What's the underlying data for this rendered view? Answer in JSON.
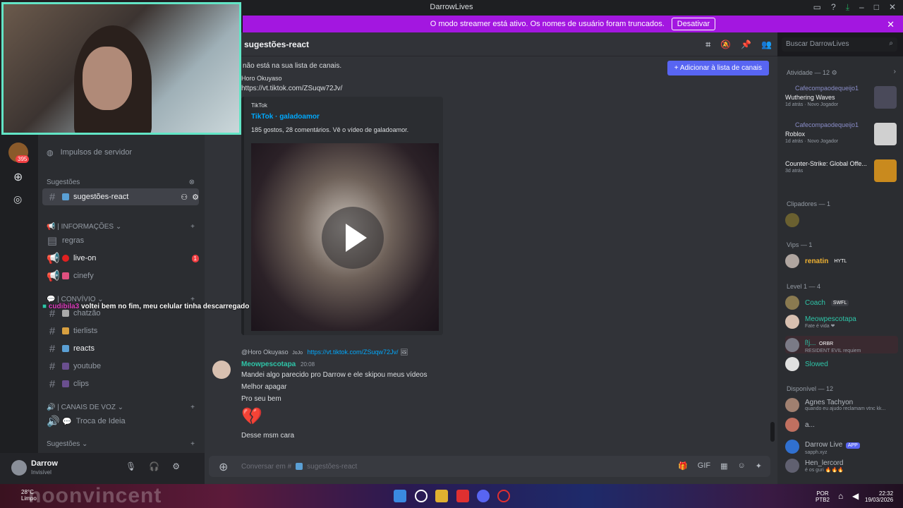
{
  "window": {
    "title": "DarrowLives"
  },
  "banner": {
    "text": "O modo streamer está ativo. Os nomes de usuário foram truncados.",
    "button": "Desativar"
  },
  "rail": {
    "badge": "395"
  },
  "sidebar": {
    "boosts": "Impulsos de servidor",
    "suggestions_header": "Sugestões",
    "active_channel": "sugestões-react",
    "cat_info": "| INFORMAÇÕES",
    "channels_info": [
      {
        "name": "regras"
      },
      {
        "name": "live-on",
        "badge": "1"
      },
      {
        "name": "cinefy"
      }
    ],
    "cat_convivio": "| CONVÍVIO",
    "channels_convivio": [
      {
        "name": "chatzão"
      },
      {
        "name": "tierlists"
      },
      {
        "name": "reacts"
      },
      {
        "name": "youtube"
      },
      {
        "name": "clips"
      }
    ],
    "cat_voice": "| CANAIS DE VOZ",
    "voice_channel": "Troca de Ideia",
    "cat_suggestions": "Sugestões"
  },
  "user": {
    "name": "Darrow",
    "status": "Invisível"
  },
  "overlay": {
    "user": "cudibila3",
    "message": "voltei bem no fim, meu celular tinha descarregado"
  },
  "chat": {
    "channel": "sugestões-react",
    "notice": "não está na sua lista de canais.",
    "add_button": "Adicionar à lista de canais",
    "top_author": "Horo Okuyaso",
    "top_link": "https://vt.tiktok.com/ZSuqw72Jv/",
    "embed": {
      "provider": "TikTok",
      "title": "TikTok · galadoamor",
      "desc": "185 gostos, 28 comentários. Vê o vídeo de galadoamor."
    },
    "reply": {
      "author": "@Horo Okuyaso",
      "tag": "JoJo",
      "link": "https://vt.tiktok.com/ZSuqw72Jv/"
    },
    "message": {
      "author": "Meowpescotapa",
      "time": "20:08",
      "lines": [
        "Mandei algo parecido pro Darrow e ele skipou meus vídeos",
        "Melhor apagar",
        "Pro seu bem"
      ],
      "emoji": "💔",
      "last": "Desse msm cara"
    },
    "composer_placeholder": "Conversar em #",
    "composer_channel": "sugestões-react"
  },
  "search": {
    "placeholder": "Buscar DarrowLives"
  },
  "members": {
    "activity_header": "Atividade — 12",
    "activities": [
      {
        "name": "Cafecompaodequeijo1",
        "game": "Wuthering Waves",
        "meta": "1d atrás",
        "extra": "Novo Jogador",
        "color": "#4a4a5a"
      },
      {
        "name": "Cafecompaodequeijo1",
        "game": "Roblox",
        "meta": "1d atrás",
        "extra": "Novo Jogador",
        "color": "#d0d0d0"
      },
      {
        "name": "",
        "game": "Counter-Strike: Global Offe...",
        "meta": "3d atrás",
        "extra": "",
        "color": "#c98a1e"
      }
    ],
    "clip_header": "Clipadores — 1",
    "vip_header": "Vips — 1",
    "vip": {
      "name": "renatin",
      "tag": "HYTL"
    },
    "level_header": "Level 1 — 4",
    "level": [
      {
        "name": "Coach",
        "tag": "SWFL",
        "sub": ""
      },
      {
        "name": "Meowpescotapa",
        "tag": "",
        "sub": "Fate é vida ❤"
      },
      {
        "name": "ſ!j...",
        "tag": "ORBR",
        "sub": "RESIDENT EVIL requiem"
      },
      {
        "name": "Slowed",
        "tag": "",
        "sub": ""
      }
    ],
    "available_header": "Disponível — 12",
    "available": [
      {
        "name": "Agnes Tachyon",
        "tag": "",
        "sub": "quando eu ajudo reclamam vtnc kk..."
      },
      {
        "name": "a...",
        "tag": "",
        "sub": ""
      },
      {
        "name": "Darrow Live",
        "tag": "APP",
        "sub": "sapph.xyz"
      },
      {
        "name": "Hen_lercord",
        "tag": "",
        "sub": "é os guri 🔥🔥🔥"
      }
    ]
  },
  "taskbar": {
    "weather_temp": "28°C",
    "weather_desc": "Limpo",
    "watermark": "noonvincent",
    "lang1": "POR",
    "lang2": "PTB2",
    "time": "22:32",
    "date": "19/03/2026"
  }
}
